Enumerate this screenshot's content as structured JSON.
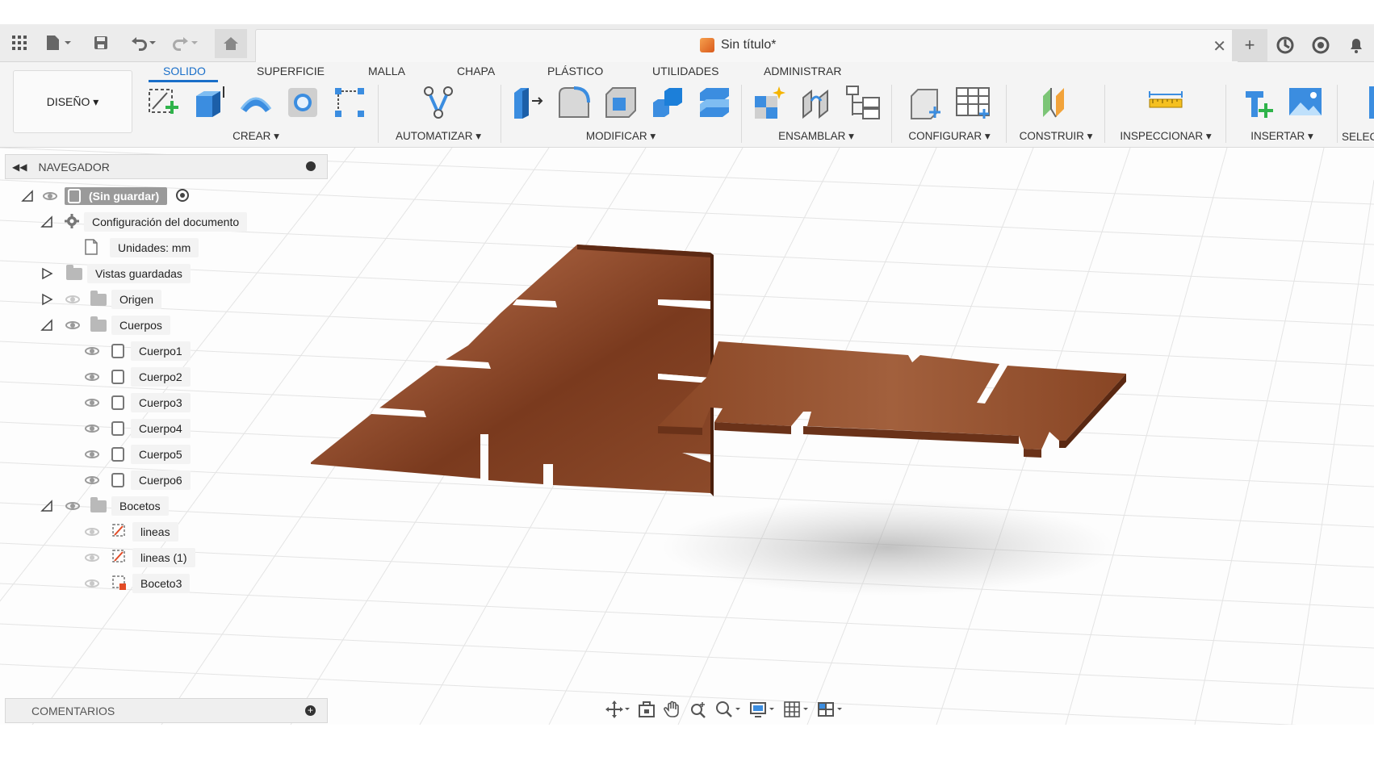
{
  "document": {
    "title": "Sin título*"
  },
  "workspace": {
    "label": "DISEÑO ▾"
  },
  "tabs": [
    {
      "label": "SOLIDO",
      "active": true
    },
    {
      "label": "SUPERFICIE"
    },
    {
      "label": "MALLA"
    },
    {
      "label": "CHAPA"
    },
    {
      "label": "PLÁSTICO"
    },
    {
      "label": "UTILIDADES"
    },
    {
      "label": "ADMINISTRAR"
    }
  ],
  "groups": [
    {
      "label": "CREAR ▾"
    },
    {
      "label": "AUTOMATIZAR ▾"
    },
    {
      "label": "MODIFICAR ▾"
    },
    {
      "label": "ENSAMBLAR ▾"
    },
    {
      "label": "CONFIGURAR ▾"
    },
    {
      "label": "CONSTRUIR ▾"
    },
    {
      "label": "INSPECCIONAR ▾"
    },
    {
      "label": "INSERTAR ▾"
    },
    {
      "label": "SELEC"
    }
  ],
  "browser": {
    "title": "NAVEGADOR",
    "root": "(Sin guardar)",
    "doc_settings": "Configuración del documento",
    "units": "Unidades: mm",
    "saved_views": "Vistas guardadas",
    "origin": "Origen",
    "bodies_folder": "Cuerpos",
    "bodies": [
      "Cuerpo1",
      "Cuerpo2",
      "Cuerpo3",
      "Cuerpo4",
      "Cuerpo5",
      "Cuerpo6"
    ],
    "sketches_folder": "Bocetos",
    "sketches": [
      "lineas",
      "lineas (1)",
      "Boceto3"
    ]
  },
  "comments": {
    "label": "COMENTARIOS"
  },
  "colors": {
    "accent": "#1a6fc9",
    "wood": "#8a4a2b",
    "wood_dark": "#6a3219"
  }
}
